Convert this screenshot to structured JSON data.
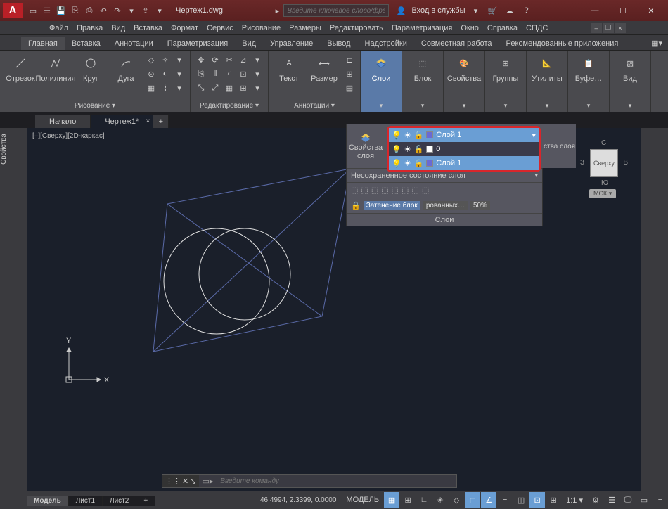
{
  "title": "Чертеж1.dwg",
  "search_placeholder": "Введите ключевое слово/фразу",
  "signin": "Вход в службы",
  "menu": [
    "Файл",
    "Правка",
    "Вид",
    "Вставка",
    "Формат",
    "Сервис",
    "Рисование",
    "Размеры",
    "Редактировать",
    "Параметризация",
    "Окно",
    "Справка",
    "СПДС"
  ],
  "ribbon_tabs": [
    "Главная",
    "Вставка",
    "Аннотации",
    "Параметризация",
    "Вид",
    "Управление",
    "Вывод",
    "Надстройки",
    "Совместная работа",
    "Рекомендованные приложения"
  ],
  "ribbon": {
    "draw_label": "Рисование ▾",
    "modify_label": "Редактирование ▾",
    "anno_label": "Аннотации ▾",
    "layers_label": "Слои",
    "block_label": "Блок",
    "props_label": "Свойства",
    "groups_label": "Группы",
    "utils_label": "Утилиты",
    "clip_label": "Буфе…",
    "view_label": "Вид",
    "segment": "Отрезок",
    "polyline": "Полилиния",
    "circle": "Круг",
    "arc": "Дуга",
    "text": "Текст",
    "dim": "Размер"
  },
  "doc_tabs": {
    "start": "Начало",
    "doc": "Чертеж1*"
  },
  "viewport_label": "[–][Сверху][2D-каркас]",
  "viewcube": {
    "face": "Сверху",
    "n": "С",
    "s": "Ю",
    "e": "В",
    "w": "З",
    "wcs": "МСК ▾"
  },
  "side_left": "Свойства",
  "layer_panel": {
    "props": "Свойства\nслоя",
    "props_side": "ства слоя",
    "current": "Слой 1",
    "layers": [
      {
        "name": "0"
      },
      {
        "name": "Слой 1"
      }
    ],
    "unsaved": "Несохраненное состояние слоя",
    "shade1": "Затенение блок",
    "shade2": "рованных…",
    "pct": "50%",
    "footer": "Слои"
  },
  "cmd_placeholder": "Введите команду",
  "status": {
    "model": "Модель",
    "sheet1": "Лист1",
    "sheet2": "Лист2",
    "coords": "46.4994, 2.3399, 0.0000",
    "space": "МОДЕЛЬ",
    "scale": "1:1 ▾"
  },
  "axes": {
    "x": "X",
    "y": "Y"
  }
}
